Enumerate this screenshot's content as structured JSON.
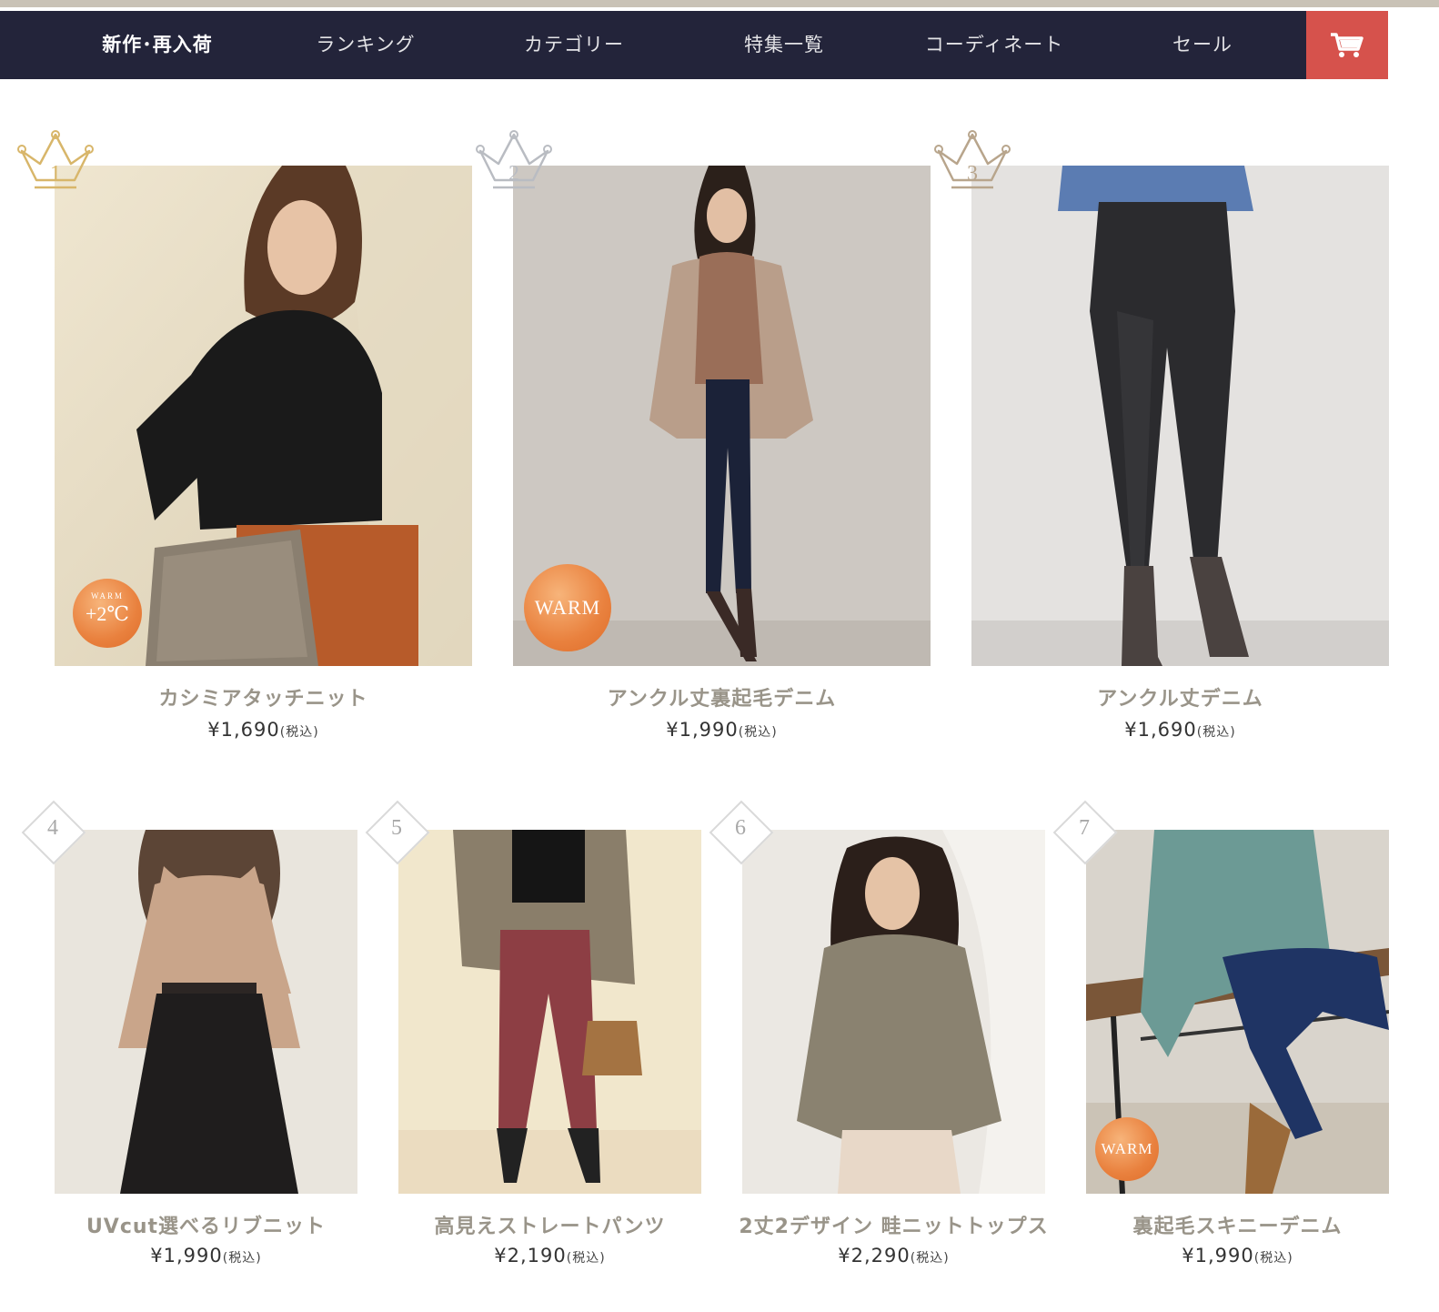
{
  "nav": {
    "items": [
      "新作･再入荷",
      "ランキング",
      "カテゴリー",
      "特集一覧",
      "コーディネート",
      "セール"
    ],
    "cart_icon": "cart-icon",
    "colors": {
      "bar": "#23243a",
      "cart": "#d6524c"
    }
  },
  "ranking": [
    {
      "rank": "1",
      "name": "カシミアタッチニット",
      "price": "¥1,690",
      "tax": "(税込)",
      "badge": {
        "top": "WARM",
        "main": "+2℃"
      }
    },
    {
      "rank": "2",
      "name": "アンクル丈裏起毛デニム",
      "price": "¥1,990",
      "tax": "(税込)",
      "badge": {
        "main": "WARM"
      }
    },
    {
      "rank": "3",
      "name": "アンクル丈デニム",
      "price": "¥1,690",
      "tax": "(税込)"
    },
    {
      "rank": "4",
      "name": "UVcut選べるリブニット",
      "price": "¥1,990",
      "tax": "(税込)"
    },
    {
      "rank": "5",
      "name": "高見えストレートパンツ",
      "price": "¥2,190",
      "tax": "(税込)"
    },
    {
      "rank": "6",
      "name": "2丈2デザイン 畦ニットトップス",
      "price": "¥2,290",
      "tax": "(税込)"
    },
    {
      "rank": "7",
      "name": "裏起毛スキニーデニム",
      "price": "¥1,990",
      "tax": "(税込)",
      "badge": {
        "main": "WARM"
      }
    }
  ]
}
